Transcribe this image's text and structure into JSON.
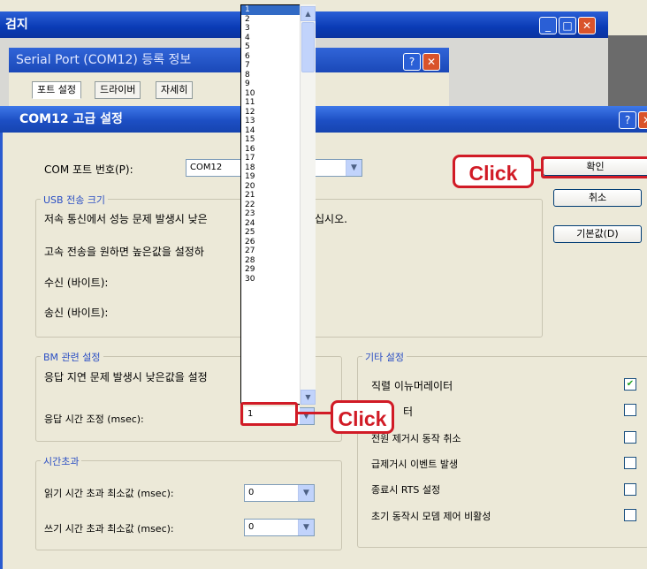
{
  "bg_window": {
    "title": "검지"
  },
  "serial_window": {
    "title": "Serial Port (COM12) 등록 정보",
    "tabs": [
      "포트 설정",
      "드라이버",
      "자세히"
    ]
  },
  "dialog": {
    "title": "COM12 고급 설정",
    "com_port_label": "COM 포트 번호(P):",
    "com_port_value": "COM12",
    "buttons": {
      "ok": "확인",
      "cancel": "취소",
      "defaults": "기본값(D)"
    },
    "usb_group": {
      "title": "USB 전송 크기",
      "line1": "저속 통신에서 성능 문제 발생시 낮은",
      "line1_end": "십시오.",
      "line2": "고속 전송을 원하면 높은값을 설정하",
      "rx": "수신 (바이트):",
      "tx": "송신 (바이트):"
    },
    "bm_group": {
      "title": "BM 관련 설정",
      "line1": "응답 지연 문제 발생시 낮은값을 설정",
      "latency_label": "응답 시간 조정 (msec):",
      "latency_value": "1"
    },
    "timeout_group": {
      "title": "시간초과",
      "read_label": "읽기 시간 초과 최소값 (msec):",
      "read_value": "0",
      "write_label": "쓰기 시간 초과 최소값 (msec):",
      "write_value": "0"
    },
    "misc_group": {
      "title": "기타 설정",
      "options": [
        {
          "label": "직렬 이뉴머레이터",
          "checked": true
        },
        {
          "label": "터",
          "checked": false
        },
        {
          "label": "전원 제거시 동작 취소",
          "checked": false
        },
        {
          "label": "급제거시 이벤트 발생",
          "checked": false
        },
        {
          "label": "종료시 RTS 설정",
          "checked": false
        },
        {
          "label": "초기 동작시 모뎀 제어 비활성",
          "checked": false
        }
      ]
    }
  },
  "latency_dropdown": {
    "items": [
      "1",
      "2",
      "3",
      "4",
      "5",
      "6",
      "7",
      "8",
      "9",
      "10",
      "11",
      "12",
      "13",
      "14",
      "15",
      "16",
      "17",
      "18",
      "19",
      "20",
      "21",
      "22",
      "23",
      "24",
      "25",
      "26",
      "27",
      "28",
      "29",
      "30"
    ],
    "selected": "1"
  },
  "callouts": {
    "ok_click": "Click",
    "latency_click": "Click"
  },
  "colors": {
    "callout_red": "#d11b26",
    "xp_title_blue": "#1d4fc4"
  }
}
